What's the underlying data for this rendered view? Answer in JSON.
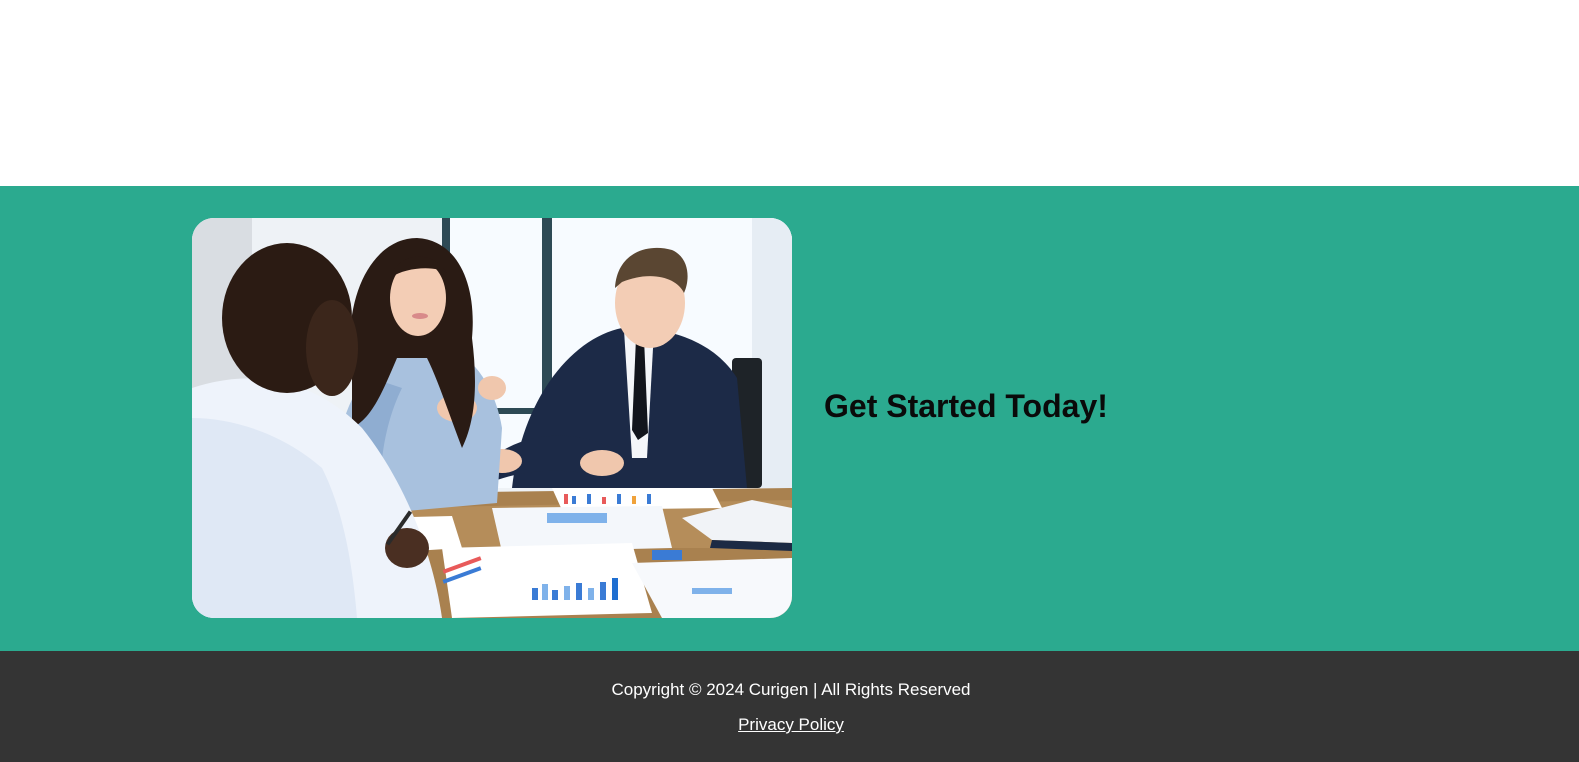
{
  "cta": {
    "heading": "Get Started Today!",
    "background_color": "#2baa8f",
    "image_alt": "Business team meeting around a table with charts"
  },
  "footer": {
    "background_color": "#343434",
    "copyright": "Copyright © 2024 Curigen | All Rights Reserved",
    "privacy_link": "Privacy Policy"
  }
}
